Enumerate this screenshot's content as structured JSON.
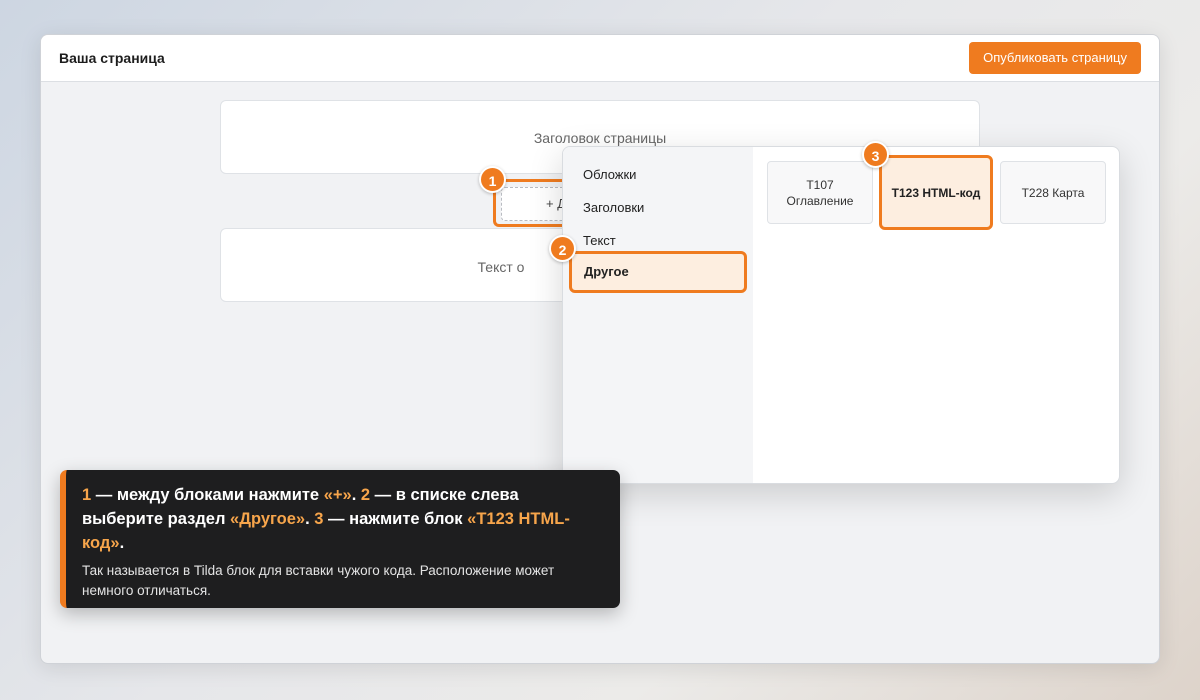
{
  "header": {
    "page_name": "Ваша страница",
    "publish_label": "Опубликовать страницу"
  },
  "blocks": {
    "title_block": "Заголовок страницы",
    "add_label": "+ Д",
    "text_block": "Текст о"
  },
  "markers": [
    "1",
    "2",
    "3"
  ],
  "panel": {
    "categories": [
      "Обложки",
      "Заголовки",
      "Текст",
      "Другое"
    ],
    "active_category": "Другое",
    "cards": [
      "T107 Оглавление",
      "T123 HTML-код",
      "T228 Карта"
    ],
    "active_card": "T123 HTML-код"
  },
  "callout": {
    "step1_num": "1",
    "step1_text": " — между блоками нажмите ",
    "step1_hl": "«+»",
    "step1_end": ". ",
    "step2_num": "2",
    "step2_text": " — в списке слева выберите раздел ",
    "step2_hl": "«Другое»",
    "step2_end": ". ",
    "step3_num": "3",
    "step3_text": " — нажмите блок ",
    "step3_hl": "«T123 HTML-код»",
    "step3_end": ".",
    "note": "Так называется в Tilda блок для вставки чужого кода. Расположение может немного отличаться."
  },
  "colors": {
    "accent": "#ef7b1f",
    "highlight_text": "#f7a54b",
    "callout_bg": "#1e1e1f"
  }
}
